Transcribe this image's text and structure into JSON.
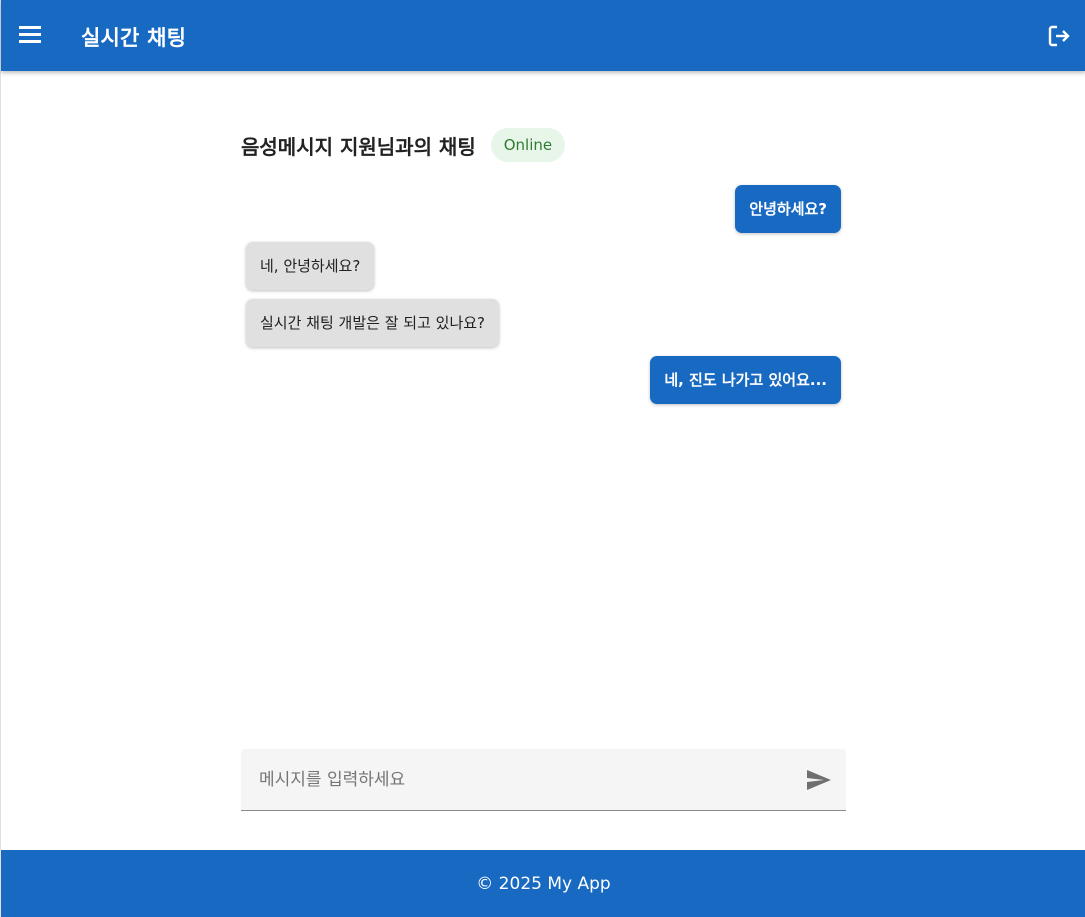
{
  "app_bar": {
    "title": "실시간 채팅",
    "menu_icon": "menu-icon",
    "logout_icon": "logout-icon",
    "color": "#1769c2"
  },
  "chat": {
    "partner_title": "음성메시지 지원님과의 채팅",
    "status": "Online",
    "status_color": "#2e7d32",
    "messages": [
      {
        "sender": "me",
        "text": "안녕하세요?"
      },
      {
        "sender": "partner",
        "text": "네, 안녕하세요?"
      },
      {
        "sender": "partner",
        "text": "실시간 채팅 개발은 잘 되고 있나요?"
      },
      {
        "sender": "me",
        "text": "네, 진도 나가고 있어요..."
      }
    ]
  },
  "composer": {
    "placeholder": "메시지를 입력하세요",
    "value": "",
    "send_icon": "send-icon"
  },
  "footer": {
    "text": "© 2025 My App"
  }
}
